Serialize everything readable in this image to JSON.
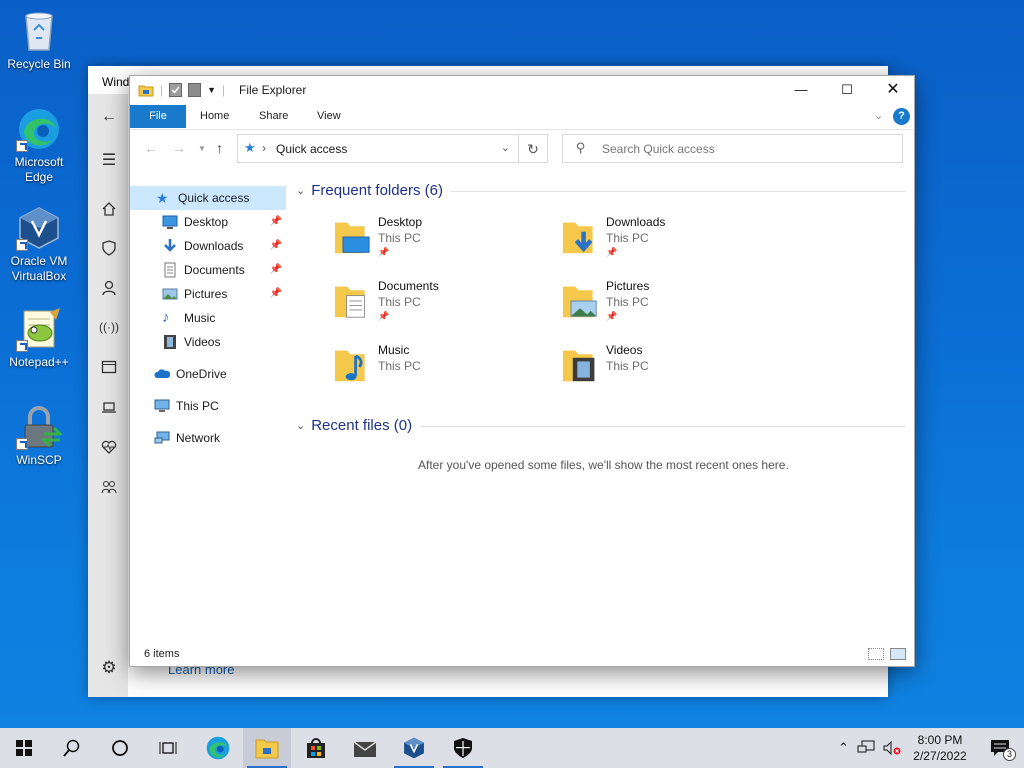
{
  "desktop": {
    "icons": [
      {
        "label": "Recycle Bin"
      },
      {
        "label": "Microsoft Edge"
      },
      {
        "label": "Oracle VM VirtualBox"
      },
      {
        "label": "Notepad++"
      },
      {
        "label": "WinSCP"
      }
    ]
  },
  "background_window": {
    "title": "Wind",
    "link": "Learn more"
  },
  "explorer": {
    "title": "File Explorer",
    "ribbon_tabs": [
      "File",
      "Home",
      "Share",
      "View"
    ],
    "address": "Quick access",
    "search_placeholder": "Search Quick access",
    "nav": {
      "quick_access": "Quick access",
      "pinned": [
        "Desktop",
        "Downloads",
        "Documents",
        "Pictures"
      ],
      "unpinned": [
        "Music",
        "Videos"
      ],
      "onedrive": "OneDrive",
      "this_pc": "This PC",
      "network": "Network"
    },
    "frequent_header": "Frequent folders (6)",
    "folders": [
      {
        "name": "Desktop",
        "location": "This PC",
        "pinned": true
      },
      {
        "name": "Downloads",
        "location": "This PC",
        "pinned": true
      },
      {
        "name": "Documents",
        "location": "This PC",
        "pinned": true
      },
      {
        "name": "Pictures",
        "location": "This PC",
        "pinned": true
      },
      {
        "name": "Music",
        "location": "This PC",
        "pinned": false
      },
      {
        "name": "Videos",
        "location": "This PC",
        "pinned": false
      }
    ],
    "recent_header": "Recent files (0)",
    "recent_empty": "After you've opened some files, we'll show the most recent ones here.",
    "status": "6 items"
  },
  "taskbar": {
    "time": "8:00 PM",
    "date": "2/27/2022",
    "notification_count": "3"
  },
  "colors": {
    "accent": "#1979ca",
    "group_header": "#1e3287",
    "folder": "#f4c84a"
  }
}
